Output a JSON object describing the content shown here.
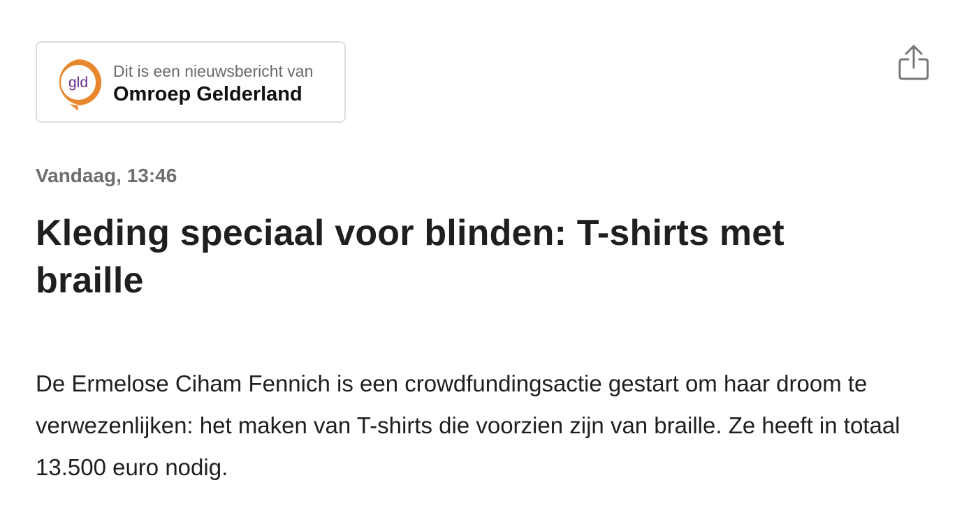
{
  "source_card": {
    "logo_text": "gld",
    "caption": "Dit is een nieuwsbericht van",
    "name": "Omroep Gelderland",
    "logo_ring_color": "#E8872E",
    "logo_text_color": "#6A2A86"
  },
  "toolbar": {
    "share_icon": "share-icon"
  },
  "article": {
    "timestamp": "Vandaag, 13:46",
    "headline": "Kleding speciaal voor blinden: T-shirts met braille",
    "lead": "De Ermelose Ciham Fennich is een crowdfundingsactie gestart om haar droom te verwezenlijken: het maken van T-shirts die voorzien zijn van braille. Ze heeft in totaal 13.500 euro nodig."
  }
}
